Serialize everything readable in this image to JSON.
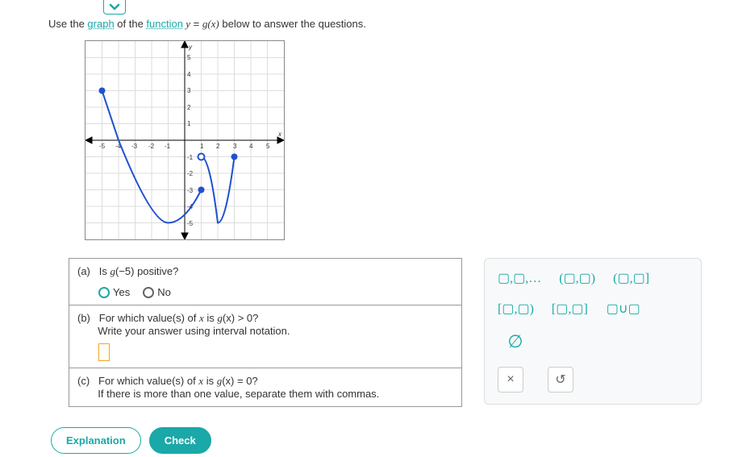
{
  "prompt": {
    "prefix": "Use the ",
    "term1": "graph",
    "mid1": " of the ",
    "term2": "function",
    "eq_lhs": " y",
    "eq_mid": " = ",
    "eq_rhs": "g",
    "eq_tail": "(x)",
    "suffix": " below to answer the questions."
  },
  "questions": {
    "a": {
      "label": "(a)",
      "text_prefix": "Is ",
      "fn": "g",
      "arg": "(−5)",
      "text_suffix": " positive?",
      "yes": "Yes",
      "no": "No"
    },
    "b": {
      "label": "(b)",
      "line1_prefix": "For which value(s) of ",
      "var": "x",
      "line1_mid": " is ",
      "fn": "g",
      "arg": "(x)",
      "cmp": " > 0?",
      "line2": "Write your answer using interval notation."
    },
    "c": {
      "label": "(c)",
      "line1_prefix": "For which value(s) of ",
      "var": "x",
      "line1_mid": " is ",
      "fn": "g",
      "arg": "(x)",
      "cmp": " = 0?",
      "line2": "If there is more than one value, separate them with commas."
    }
  },
  "palette": {
    "list": "▢,▢,…",
    "open_open": "(▢,▢)",
    "open_closed": "(▢,▢]",
    "closed_open": "[▢,▢)",
    "closed_closed": "[▢,▢]",
    "union": "▢∪▢",
    "empty": "∅",
    "close": "×",
    "reset": "↺"
  },
  "buttons": {
    "explanation": "Explanation",
    "check": "Check"
  },
  "graph": {
    "xmin": -6,
    "xmax": 6,
    "ymin": -6,
    "ymax": 6,
    "xlabel": "x",
    "ylabel": "y",
    "points": [
      {
        "x": -5,
        "y": 3,
        "open": false,
        "type": "endpoint"
      },
      {
        "x": -4,
        "y": 0,
        "type": "line"
      },
      {
        "x": -1,
        "y": -5,
        "type": "line"
      },
      {
        "x": 1,
        "y": -3,
        "open": false,
        "type": "endpoint"
      },
      {
        "x": 1,
        "y": -1,
        "open": true,
        "type": "start"
      },
      {
        "x": 2,
        "y": -5,
        "type": "line"
      },
      {
        "x": 3,
        "y": -1,
        "open": false,
        "type": "endpoint"
      }
    ]
  }
}
